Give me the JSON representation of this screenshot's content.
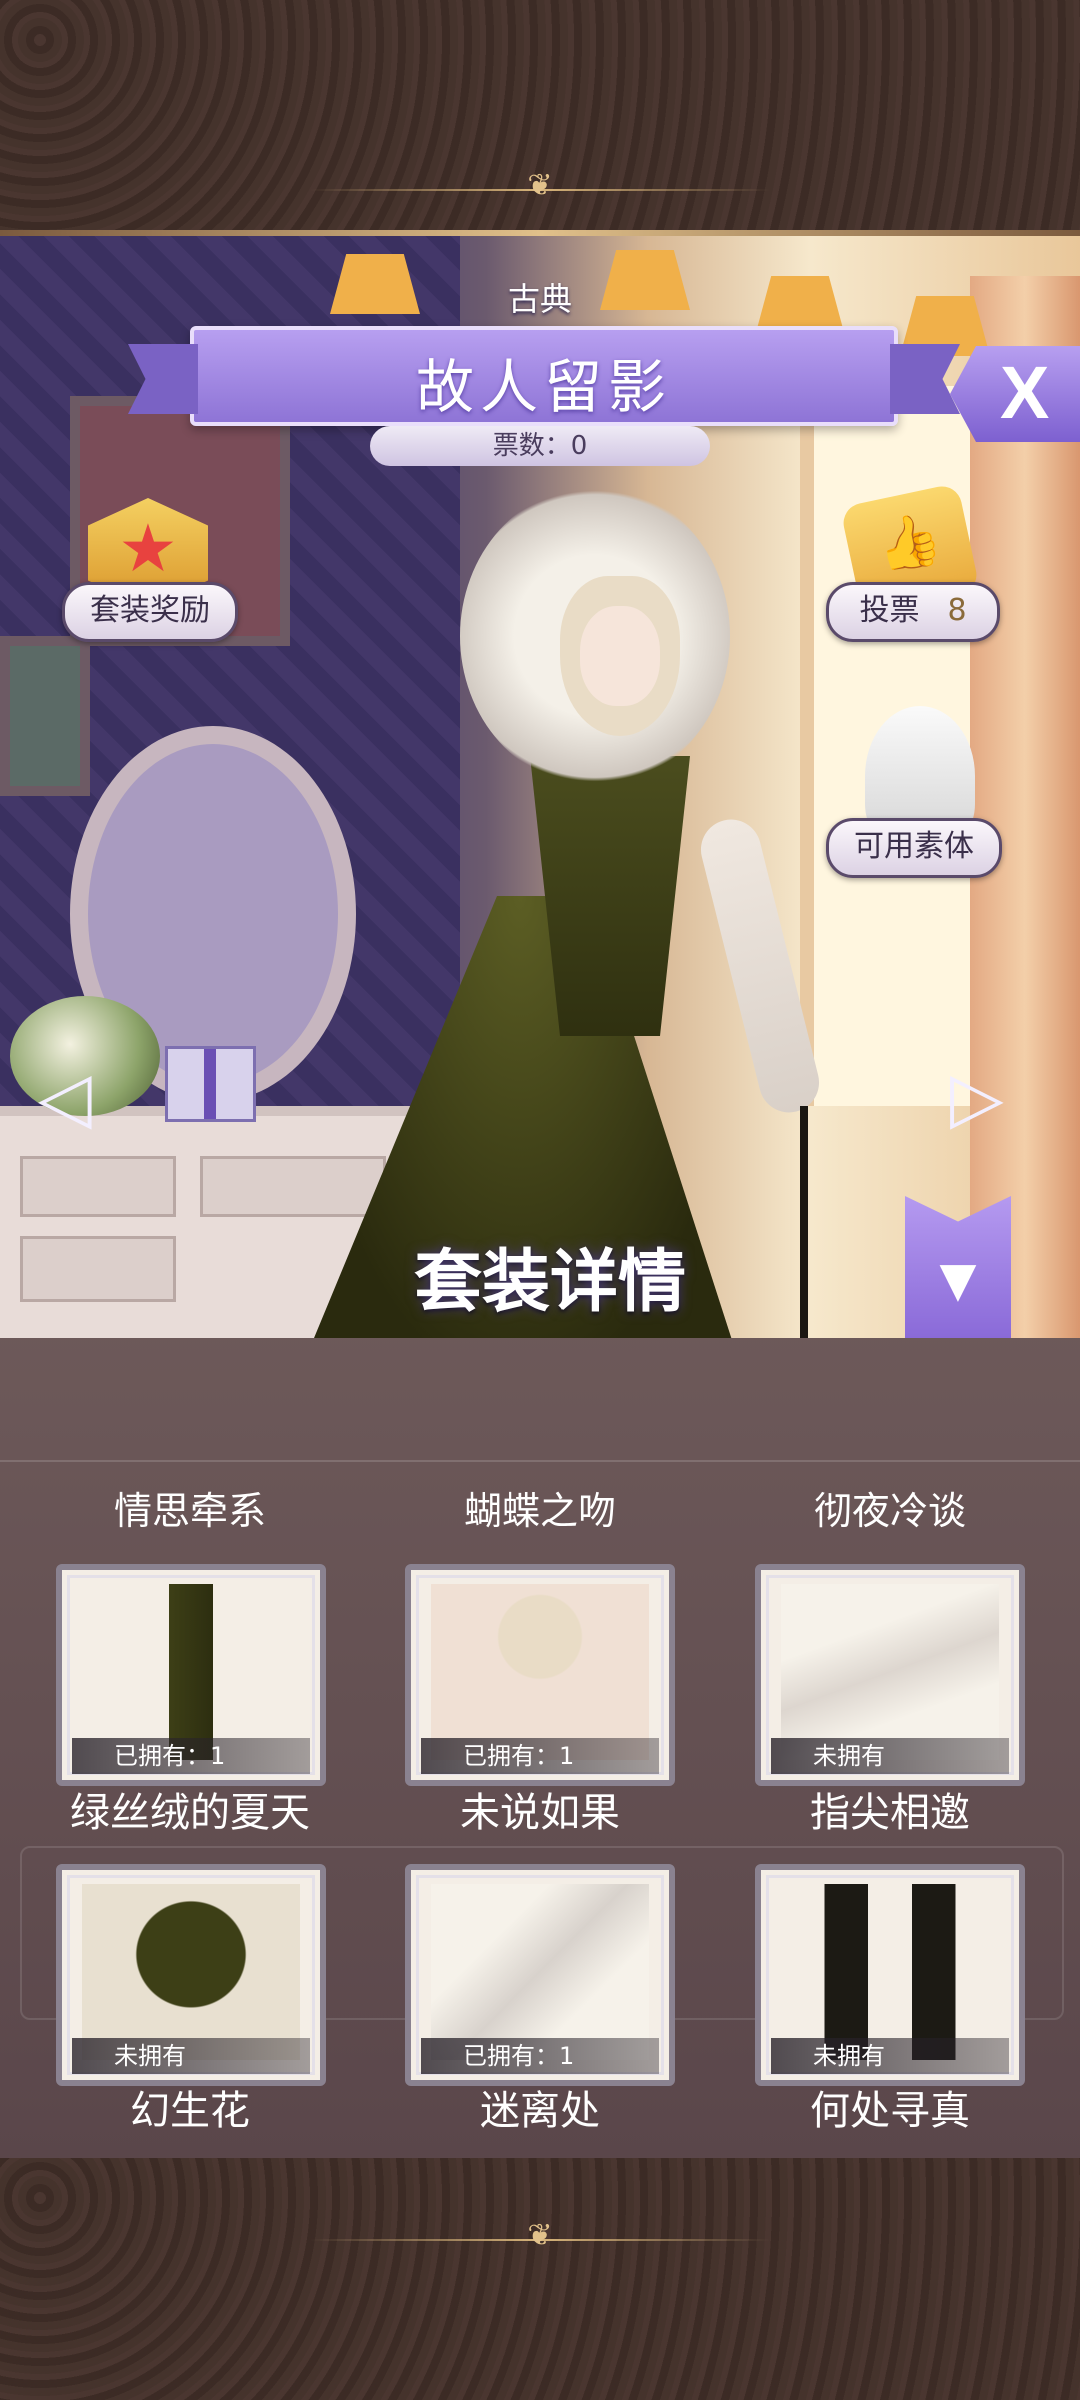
{
  "header": {
    "category": "古典",
    "title": "故人留影",
    "votes_label": "票数：0"
  },
  "buttons": {
    "close": "X",
    "suit_reward": "套装奖励",
    "vote": "投票",
    "vote_count": "8",
    "available_body": "可用素体",
    "collapse": "▼"
  },
  "detail_title": "套装详情",
  "groups": [
    {
      "name": "情思牵系",
      "items": [
        {
          "name": "绿丝绒的夏天",
          "owned": "已拥有：1"
        },
        {
          "name": "幻生花",
          "owned": "未拥有"
        }
      ]
    },
    {
      "name": "蝴蝶之吻",
      "items": [
        {
          "name": "未说如果",
          "owned": "已拥有：1"
        },
        {
          "name": "迷离处",
          "owned": "已拥有：1"
        }
      ]
    },
    {
      "name": "彻夜冷谈",
      "items": [
        {
          "name": "指尖相邀",
          "owned": "未拥有"
        },
        {
          "name": "何处寻真",
          "owned": "未拥有"
        }
      ]
    }
  ],
  "colors": {
    "accent_purple": "#9b82e0",
    "panel_bg": "#6a5658",
    "frame_gold": "#d8b57a"
  }
}
